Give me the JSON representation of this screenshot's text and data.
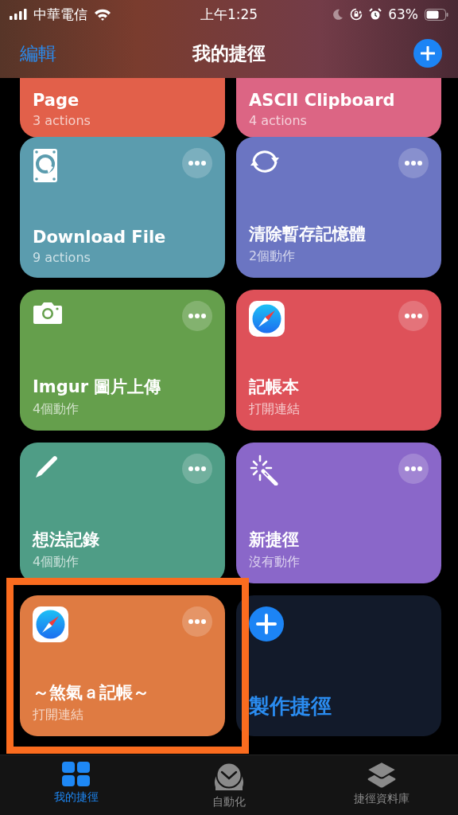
{
  "status_bar": {
    "carrier": "中華電信",
    "time": "上午1:25",
    "battery": "63%"
  },
  "nav": {
    "edit": "編輯",
    "title": "我的捷徑"
  },
  "shortcuts": [
    {
      "title": "Page",
      "subtitle": "3 actions",
      "kind": "partial",
      "color": "#e2604a",
      "highlighted": false
    },
    {
      "title": "ASCII Clipboard",
      "subtitle": "4 actions",
      "kind": "partial",
      "color": "#dc6584",
      "highlighted": false
    },
    {
      "title": "Download File",
      "subtitle": "9 actions",
      "kind": "drive",
      "color": "#5b9cae",
      "highlighted": false
    },
    {
      "title": "清除暫存記憶體",
      "subtitle": "2個動作",
      "kind": "sync",
      "color": "#6b75c2",
      "highlighted": false
    },
    {
      "title": "Imgur 圖片上傳",
      "subtitle": "4個動作",
      "kind": "camera",
      "color": "#659f4c",
      "highlighted": false
    },
    {
      "title": "記帳本",
      "subtitle": "打開連結",
      "kind": "compass",
      "color": "#de5159",
      "highlighted": false
    },
    {
      "title": "想法記錄",
      "subtitle": "4個動作",
      "kind": "pencil",
      "color": "#4f9d86",
      "highlighted": false
    },
    {
      "title": "新捷徑",
      "subtitle": "沒有動作",
      "kind": "wand",
      "color": "#8a67c9",
      "highlighted": false
    },
    {
      "title": "～煞氣ａ記帳～",
      "subtitle": "打開連結",
      "kind": "compass",
      "color": "#df7b42",
      "highlighted": true
    }
  ],
  "create": {
    "label": "製作捷徑"
  },
  "tabs": [
    {
      "label": "我的捷徑",
      "kind": "grid",
      "selected": true
    },
    {
      "label": "自動化",
      "kind": "clock",
      "selected": false
    },
    {
      "label": "捷徑資料庫",
      "kind": "layers",
      "selected": false
    }
  ]
}
